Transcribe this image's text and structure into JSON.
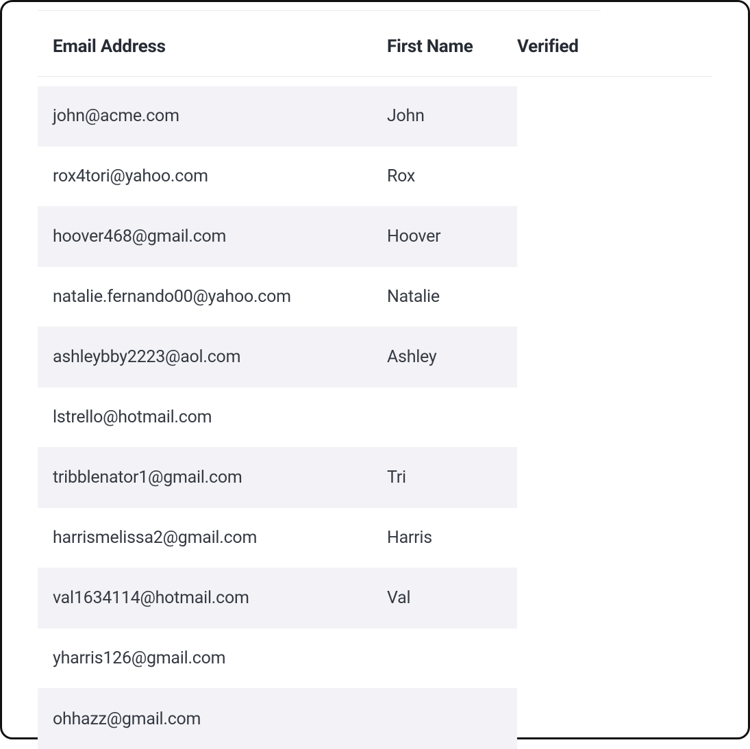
{
  "table": {
    "headers": {
      "email": "Email Address",
      "first_name": "First Name",
      "verified": "Verified"
    },
    "rows": [
      {
        "email": "john@acme.com",
        "first_name": "John"
      },
      {
        "email": "rox4tori@yahoo.com",
        "first_name": "Rox"
      },
      {
        "email": "hoover468@gmail.com",
        "first_name": "Hoover"
      },
      {
        "email": "natalie.fernando00@yahoo.com",
        "first_name": "Natalie"
      },
      {
        "email": "ashleybby2223@aol.com",
        "first_name": "Ashley"
      },
      {
        "email": "lstrello@hotmail.com",
        "first_name": ""
      },
      {
        "email": "tribblenator1@gmail.com",
        "first_name": "Tri"
      },
      {
        "email": "harrismelissa2@gmail.com",
        "first_name": "Harris"
      },
      {
        "email": "val1634114@hotmail.com",
        "first_name": "Val"
      },
      {
        "email": "yharris126@gmail.com",
        "first_name": ""
      },
      {
        "email": "ohhazz@gmail.com",
        "first_name": ""
      }
    ]
  }
}
